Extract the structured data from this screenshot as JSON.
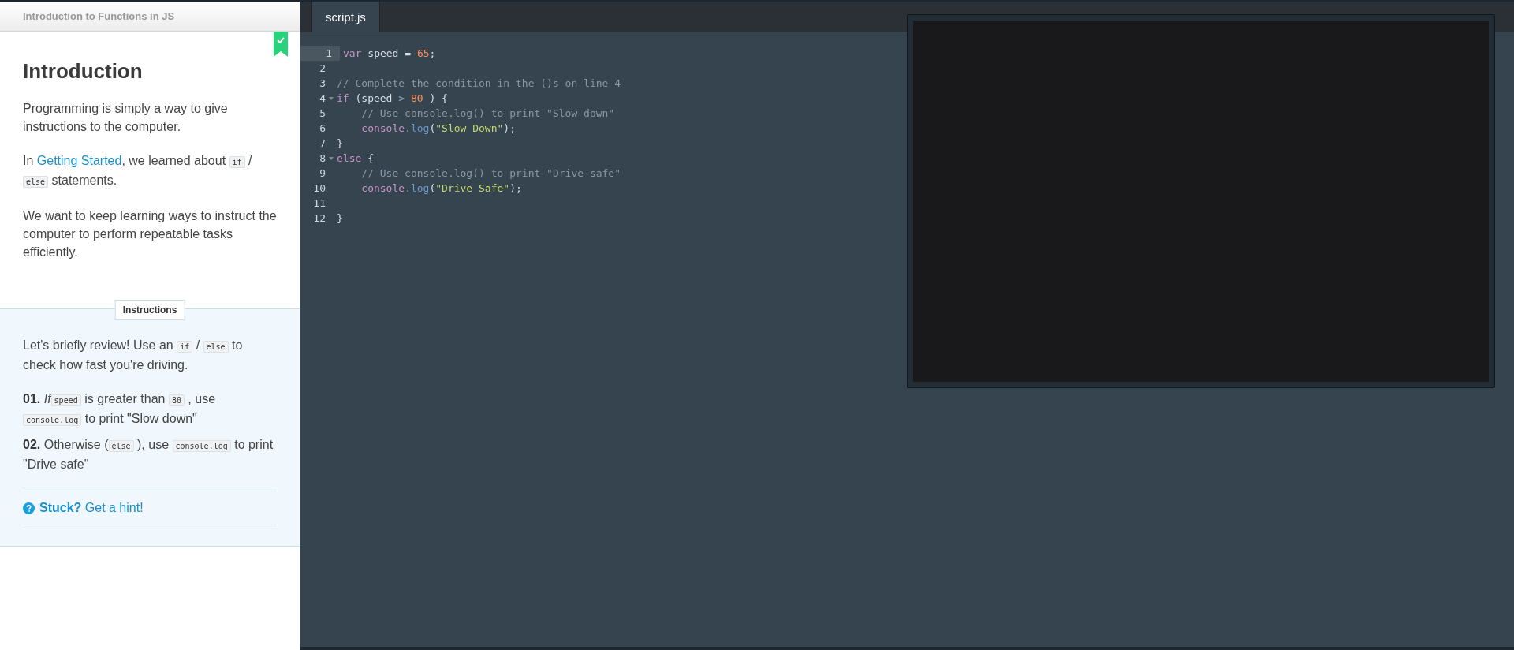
{
  "lesson": {
    "course_title": "Introduction to Functions in JS",
    "completed": true,
    "heading": "Introduction",
    "paragraphs": [
      [
        {
          "kind": "text",
          "text": "Programming is simply a way to give instructions to the computer."
        }
      ],
      [
        {
          "kind": "text",
          "text": "In "
        },
        {
          "kind": "link",
          "text": "Getting Started"
        },
        {
          "kind": "text",
          "text": ", we learned about "
        },
        {
          "kind": "code",
          "text": "if"
        },
        {
          "kind": "text",
          "text": " / "
        },
        {
          "kind": "code",
          "text": "else"
        },
        {
          "kind": "text",
          "text": " statements."
        }
      ],
      [
        {
          "kind": "text",
          "text": "We want to keep learning ways to instruct the computer to perform repeatable tasks efficiently."
        }
      ]
    ]
  },
  "instructions": {
    "label": "Instructions",
    "intro": [
      {
        "kind": "text",
        "text": "Let's briefly review! Use an "
      },
      {
        "kind": "code",
        "text": "if"
      },
      {
        "kind": "text",
        "text": " / "
      },
      {
        "kind": "code",
        "text": "else"
      },
      {
        "kind": "text",
        "text": " to check how fast you're driving."
      }
    ],
    "steps": [
      {
        "number": "01.",
        "segments": [
          {
            "kind": "text",
            "text": "*If*"
          },
          {
            "kind": "code",
            "text": "speed"
          },
          {
            "kind": "text",
            "text": " is greater than "
          },
          {
            "kind": "code",
            "text": "80"
          },
          {
            "kind": "text",
            "text": ", use "
          },
          {
            "kind": "code",
            "text": "console.log"
          },
          {
            "kind": "text",
            "text": " to print \"Slow down\""
          }
        ]
      },
      {
        "number": "02.",
        "segments": [
          {
            "kind": "text",
            "text": "Otherwise ("
          },
          {
            "kind": "code",
            "text": "else"
          },
          {
            "kind": "text",
            "text": "), use "
          },
          {
            "kind": "code",
            "text": "console.log"
          },
          {
            "kind": "text",
            "text": " to print \"Drive safe\""
          }
        ]
      }
    ],
    "hint": {
      "label": "Stuck?",
      "link": "Get a hint!"
    }
  },
  "editor": {
    "tabs": [
      {
        "label": "script.js",
        "selected": true
      }
    ],
    "lines": [
      {
        "number": "1",
        "active": true,
        "fold": false,
        "tokens": [
          {
            "kind": "keyword",
            "text": "var"
          },
          {
            "kind": "plain",
            "text": " speed = "
          },
          {
            "kind": "number",
            "text": "65"
          },
          {
            "kind": "plain",
            "text": ";"
          }
        ]
      },
      {
        "number": "2",
        "active": false,
        "fold": false
      },
      {
        "number": "3",
        "active": false,
        "fold": false,
        "tokens": [
          {
            "kind": "comment",
            "text": "// Complete the condition in the ()s on line 4"
          }
        ]
      },
      {
        "number": "4",
        "active": false,
        "fold": true,
        "tokens": [
          {
            "kind": "keyword",
            "text": "if"
          },
          {
            "kind": "plain",
            "text": " (speed "
          },
          {
            "kind": "operator",
            "text": ">"
          },
          {
            "kind": "number",
            "text": " 80"
          },
          {
            "kind": "plain",
            "text": " ) {"
          }
        ]
      },
      {
        "number": "5",
        "active": false,
        "fold": false,
        "tokens": [
          {
            "kind": "comment",
            "text": "    // Use console.log() to print \"Slow down\""
          }
        ]
      },
      {
        "number": "6",
        "active": false,
        "fold": false,
        "tokens": [
          {
            "kind": "keyword",
            "text": "    console"
          },
          {
            "kind": "function",
            "text": ".log"
          },
          {
            "kind": "plain",
            "text": "("
          },
          {
            "kind": "string",
            "text": "\"Slow Down\""
          },
          {
            "kind": "plain",
            "text": ");"
          }
        ]
      },
      {
        "number": "7",
        "active": false,
        "fold": false,
        "tokens": [
          {
            "kind": "plain",
            "text": "}"
          }
        ]
      },
      {
        "number": "8",
        "active": false,
        "fold": true,
        "tokens": [
          {
            "kind": "keyword",
            "text": "else"
          },
          {
            "kind": "plain",
            "text": " {"
          }
        ]
      },
      {
        "number": "9",
        "active": false,
        "fold": false,
        "tokens": [
          {
            "kind": "comment",
            "text": "    // Use console.log() to print \"Drive safe\""
          }
        ]
      },
      {
        "number": "10",
        "active": false,
        "fold": false,
        "tokens": [
          {
            "kind": "keyword",
            "text": "    console"
          },
          {
            "kind": "function",
            "text": ".log"
          },
          {
            "kind": "plain",
            "text": "("
          },
          {
            "kind": "string",
            "text": "\"Drive Safe\""
          },
          {
            "kind": "plain",
            "text": ");"
          }
        ]
      },
      {
        "number": "11",
        "active": false,
        "fold": false
      },
      {
        "number": "12",
        "active": false,
        "fold": false,
        "tokens": [
          {
            "kind": "plain",
            "text": "}"
          }
        ]
      }
    ]
  }
}
